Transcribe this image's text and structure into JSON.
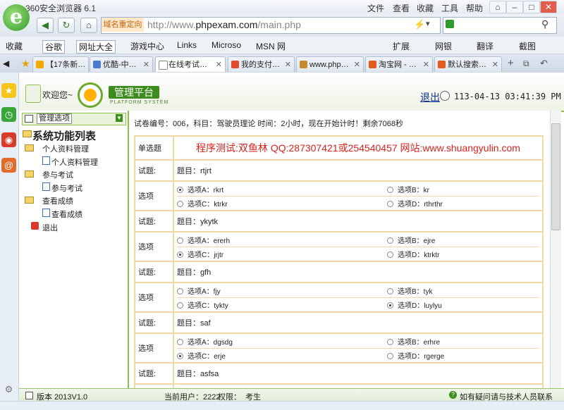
{
  "browser": {
    "title": "360安全浏览器 6.1",
    "menu": [
      "文件",
      "查看",
      "收藏",
      "工具",
      "帮助"
    ],
    "dns_tag": "域名重定向",
    "url_host": "http://www.",
    "url_domain": "phpexam.com",
    "url_path": "/main.php",
    "bookmarks": [
      "收藏",
      "谷歌",
      "网址大全",
      "游戏中心",
      "Links",
      "Microso",
      "MSN 网",
      "扩展",
      "网银",
      "翻译",
      "截图"
    ],
    "tabs": [
      "【17条新…",
      "优酷-中…",
      "在线考试…",
      "我的支付…",
      "www.php…",
      "淘宝网 - …",
      "默认搜索…"
    ]
  },
  "header": {
    "welcome": "欢迎您~",
    "platform": "管理平台",
    "platform_sub": "PLATFORM SYSTEM",
    "logout": "退出",
    "datetime": "113-04-13 03:41:39 PM"
  },
  "sidebar": {
    "panel_label": "管理选项",
    "title": "系统功能列表",
    "groups": [
      {
        "label": "个人资料管理",
        "child": "个人资料管理"
      },
      {
        "label": "参与考试",
        "child": "参与考试"
      },
      {
        "label": "查看成绩",
        "child": "查看成绩"
      }
    ],
    "exit": "退出"
  },
  "exam": {
    "info": "试卷编号：006，科目：驾驶员理论 时间：2小时，现在开始计时！剩余7068秒",
    "type_label": "单选题",
    "banner": "程序测试:双鱼林 QQ:287307421或254540457 网站:www.shuangyulin.com",
    "question_label": "试题:",
    "option_label": "选项",
    "questions": [
      {
        "text": "题目：rtjrt",
        "options": [
          "选项A：rkrt",
          "选项B：kr",
          "选项C：ktrkr",
          "选项D：rthrthr"
        ],
        "selected": 0
      },
      {
        "text": "题目：ykytk",
        "options": [
          "选项A：ererh",
          "选项B：ejre",
          "选项C：jrjtr",
          "选项D：ktrktr"
        ],
        "selected": 2
      },
      {
        "text": "题目：gfh",
        "options": [
          "选项A：fjy",
          "选项B：tyk",
          "选项C：tykty",
          "选项D：luylyu"
        ],
        "selected": 3
      },
      {
        "text": "题目：saf",
        "options": [
          "选项A：dgsdg",
          "选项B：erhre",
          "选项C：erje",
          "选项D：rgerge"
        ],
        "selected": 2
      },
      {
        "text": "题目：asfsa",
        "options": [],
        "selected": -1
      }
    ]
  },
  "status": {
    "version": "版本 2013V1.0",
    "user_label": "当前用户：",
    "user": "2222",
    "role_label": "权限：",
    "role": "考生",
    "help": "如有疑问请与技术人员联系"
  },
  "colors": {
    "accent": "#8bc34a",
    "brand": "#3c8c1e",
    "banner": "#d9231d",
    "grid": "#f0d9a4"
  }
}
